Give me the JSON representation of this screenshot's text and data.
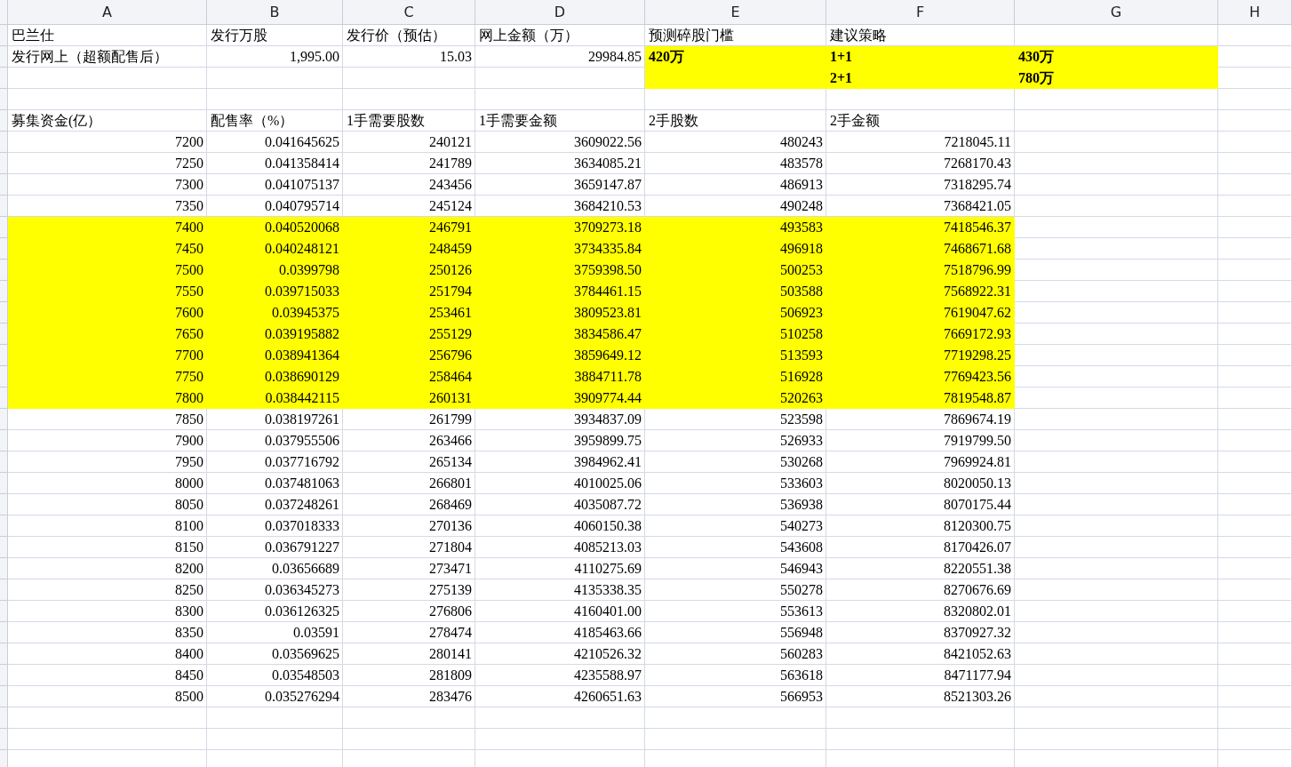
{
  "column_headers": [
    "A",
    "B",
    "C",
    "D",
    "E",
    "F",
    "G",
    "H"
  ],
  "top_rows": [
    {
      "cells": [
        {
          "kind": "text",
          "text": "巴兰仕",
          "bold": false,
          "highlighted": false
        },
        {
          "kind": "text",
          "text": "发行万股",
          "bold": false,
          "highlighted": false
        },
        {
          "kind": "text",
          "text": "发行价（预估）",
          "bold": false,
          "highlighted": false
        },
        {
          "kind": "text",
          "text": "网上金额（万）",
          "bold": false,
          "highlighted": false
        },
        {
          "kind": "text",
          "text": "预测碎股门槛",
          "bold": false,
          "highlighted": false
        },
        {
          "kind": "text",
          "text": "建议策略",
          "bold": false,
          "highlighted": false
        }
      ]
    },
    {
      "cells": [
        {
          "kind": "text",
          "text": "发行网上（超额配售后）",
          "bold": false,
          "highlighted": false
        },
        {
          "kind": "number",
          "text": "1,995.00",
          "bold": false,
          "highlighted": false
        },
        {
          "kind": "number",
          "text": "15.03",
          "bold": false,
          "highlighted": false
        },
        {
          "kind": "number",
          "text": "29984.85",
          "bold": false,
          "highlighted": false
        },
        {
          "kind": "text",
          "text": "420万",
          "bold": true,
          "highlighted": true
        },
        {
          "kind": "text",
          "text": "1+1",
          "bold": true,
          "highlighted": true
        },
        {
          "kind": "text",
          "text": "430万",
          "bold": true,
          "highlighted": true
        }
      ]
    },
    {
      "cells": [
        {
          "kind": "empty",
          "highlighted": false
        },
        {
          "kind": "empty",
          "highlighted": false
        },
        {
          "kind": "empty",
          "highlighted": false
        },
        {
          "kind": "empty",
          "highlighted": false
        },
        {
          "kind": "empty",
          "highlighted": true
        },
        {
          "kind": "text",
          "text": "2+1",
          "bold": true,
          "highlighted": true
        },
        {
          "kind": "text",
          "text": "780万",
          "bold": true,
          "highlighted": true
        }
      ]
    },
    {
      "cells": []
    },
    {
      "cells": [
        {
          "kind": "text",
          "text": "募集资金(亿）",
          "bold": false,
          "highlighted": false
        },
        {
          "kind": "text",
          "text": "配售率（%）",
          "bold": false,
          "highlighted": false
        },
        {
          "kind": "text",
          "text": "1手需要股数",
          "bold": false,
          "highlighted": false
        },
        {
          "kind": "text",
          "text": "1手需要金额",
          "bold": false,
          "highlighted": false
        },
        {
          "kind": "text",
          "text": "2手股数",
          "bold": false,
          "highlighted": false
        },
        {
          "kind": "text",
          "text": "2手金额",
          "bold": false,
          "highlighted": false
        }
      ]
    }
  ],
  "data_rows": [
    {
      "values": [
        "7200",
        "0.041645625",
        "240121",
        "3609022.56",
        "480243",
        "7218045.11"
      ],
      "highlighted": false
    },
    {
      "values": [
        "7250",
        "0.041358414",
        "241789",
        "3634085.21",
        "483578",
        "7268170.43"
      ],
      "highlighted": false
    },
    {
      "values": [
        "7300",
        "0.041075137",
        "243456",
        "3659147.87",
        "486913",
        "7318295.74"
      ],
      "highlighted": false
    },
    {
      "values": [
        "7350",
        "0.040795714",
        "245124",
        "3684210.53",
        "490248",
        "7368421.05"
      ],
      "highlighted": false
    },
    {
      "values": [
        "7400",
        "0.040520068",
        "246791",
        "3709273.18",
        "493583",
        "7418546.37"
      ],
      "highlighted": true
    },
    {
      "values": [
        "7450",
        "0.040248121",
        "248459",
        "3734335.84",
        "496918",
        "7468671.68"
      ],
      "highlighted": true
    },
    {
      "values": [
        "7500",
        "0.0399798",
        "250126",
        "3759398.50",
        "500253",
        "7518796.99"
      ],
      "highlighted": true
    },
    {
      "values": [
        "7550",
        "0.039715033",
        "251794",
        "3784461.15",
        "503588",
        "7568922.31"
      ],
      "highlighted": true
    },
    {
      "values": [
        "7600",
        "0.03945375",
        "253461",
        "3809523.81",
        "506923",
        "7619047.62"
      ],
      "highlighted": true
    },
    {
      "values": [
        "7650",
        "0.039195882",
        "255129",
        "3834586.47",
        "510258",
        "7669172.93"
      ],
      "highlighted": true
    },
    {
      "values": [
        "7700",
        "0.038941364",
        "256796",
        "3859649.12",
        "513593",
        "7719298.25"
      ],
      "highlighted": true
    },
    {
      "values": [
        "7750",
        "0.038690129",
        "258464",
        "3884711.78",
        "516928",
        "7769423.56"
      ],
      "highlighted": true
    },
    {
      "values": [
        "7800",
        "0.038442115",
        "260131",
        "3909774.44",
        "520263",
        "7819548.87"
      ],
      "highlighted": true
    },
    {
      "values": [
        "7850",
        "0.038197261",
        "261799",
        "3934837.09",
        "523598",
        "7869674.19"
      ],
      "highlighted": false
    },
    {
      "values": [
        "7900",
        "0.037955506",
        "263466",
        "3959899.75",
        "526933",
        "7919799.50"
      ],
      "highlighted": false
    },
    {
      "values": [
        "7950",
        "0.037716792",
        "265134",
        "3984962.41",
        "530268",
        "7969924.81"
      ],
      "highlighted": false
    },
    {
      "values": [
        "8000",
        "0.037481063",
        "266801",
        "4010025.06",
        "533603",
        "8020050.13"
      ],
      "highlighted": false
    },
    {
      "values": [
        "8050",
        "0.037248261",
        "268469",
        "4035087.72",
        "536938",
        "8070175.44"
      ],
      "highlighted": false
    },
    {
      "values": [
        "8100",
        "0.037018333",
        "270136",
        "4060150.38",
        "540273",
        "8120300.75"
      ],
      "highlighted": false
    },
    {
      "values": [
        "8150",
        "0.036791227",
        "271804",
        "4085213.03",
        "543608",
        "8170426.07"
      ],
      "highlighted": false
    },
    {
      "values": [
        "8200",
        "0.03656689",
        "273471",
        "4110275.69",
        "546943",
        "8220551.38"
      ],
      "highlighted": false
    },
    {
      "values": [
        "8250",
        "0.036345273",
        "275139",
        "4135338.35",
        "550278",
        "8270676.69"
      ],
      "highlighted": false
    },
    {
      "values": [
        "8300",
        "0.036126325",
        "276806",
        "4160401.00",
        "553613",
        "8320802.01"
      ],
      "highlighted": false
    },
    {
      "values": [
        "8350",
        "0.03591",
        "278474",
        "4185463.66",
        "556948",
        "8370927.32"
      ],
      "highlighted": false
    },
    {
      "values": [
        "8400",
        "0.03569625",
        "280141",
        "4210526.32",
        "560283",
        "8421052.63"
      ],
      "highlighted": false
    },
    {
      "values": [
        "8450",
        "0.03548503",
        "281809",
        "4235588.97",
        "563618",
        "8471177.94"
      ],
      "highlighted": false
    },
    {
      "values": [
        "8500",
        "0.035276294",
        "283476",
        "4260651.63",
        "566953",
        "8521303.26"
      ],
      "highlighted": false
    }
  ]
}
